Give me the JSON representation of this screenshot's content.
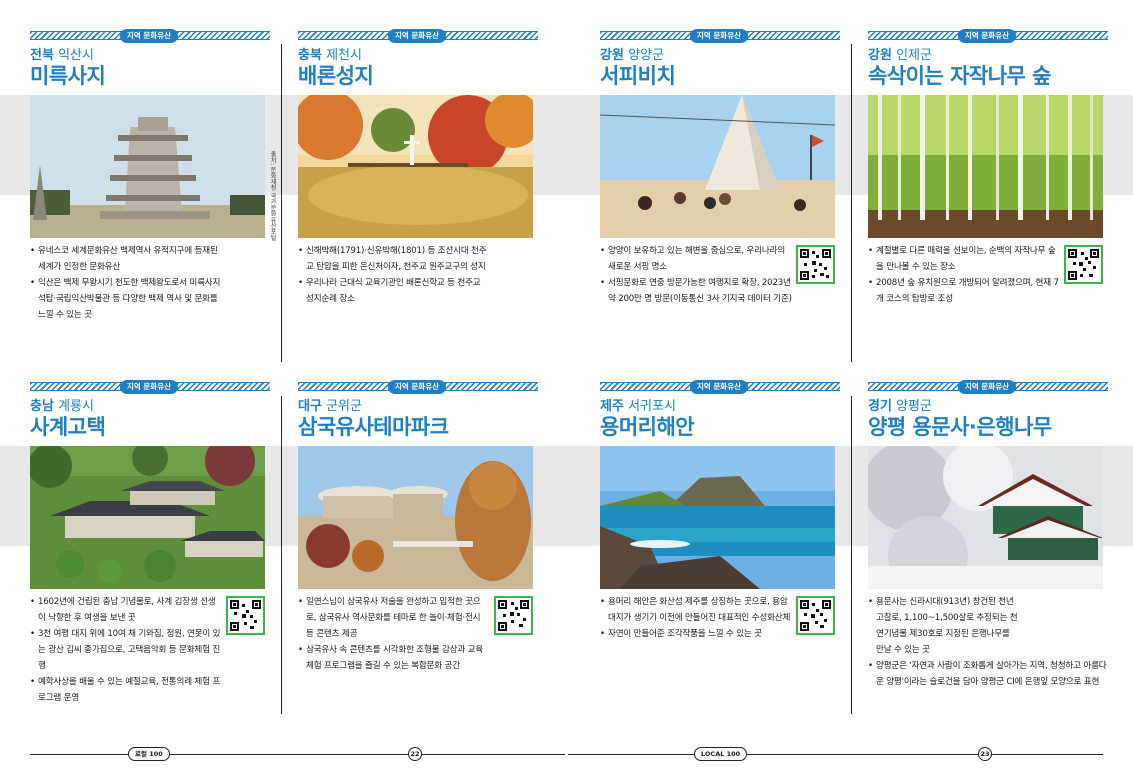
{
  "badge_label": "지역 문화유산",
  "cards": [
    {
      "province": "전북",
      "city": "익산시",
      "title": "미륵사지",
      "bullets": [
        "유네스코 세계문화유산 백제역사 유적지구에 등재된 세계가 인정한 문화유산",
        "익산은 백제 무왕시기 천도한 백제왕도로서 미륵사지석탑·국립익산박물관 등 다양한 백제 역사 및 문화를 느낄 수 있는 곳"
      ],
      "credit": "출처: 문화재청 국가문화유산포털",
      "has_qr": false,
      "photo": "stone-pagoda"
    },
    {
      "province": "충북",
      "city": "제천시",
      "title": "배론성지",
      "bullets": [
        "신해박해(1791)·신유박해(1801) 등 조선시대 천주교 탄압을 피한 은신처이자, 천주교 원주교구의 성지",
        "우리나라 근대식 교육기관인 배론신학교 등 천주교 성지순례 장소"
      ],
      "has_qr": false,
      "photo": "autumn-pond"
    },
    {
      "province": "강원",
      "city": "양양군",
      "title": "서피비치",
      "bullets": [
        "양양이 보유하고 있는 해변을 중심으로, 우리나라의 새로운 서핑 명소",
        "서핑문화로 연중 방문가능한 여행지로 확장, 2023년 약 200만 명 방문(이동통신 3사 기지국 데이터 기준)"
      ],
      "has_qr": true,
      "photo": "beach-tent"
    },
    {
      "province": "강원",
      "city": "인제군",
      "title": "속삭이는 자작나무 숲",
      "bullets": [
        "계절별로 다른 매력을 선보이는, 순백의 자작나무 숲을 만나볼 수 있는 장소",
        "2008년 숲 유치원으로 개방되어 알려졌으며, 현재 7개 코스의 탐방로 조성"
      ],
      "has_qr": true,
      "photo": "birch-forest"
    },
    {
      "province": "충남",
      "city": "계룡시",
      "title": "사계고택",
      "bullets": [
        "1602년에 건립된 충남 기념물로, 사계 김장생 선생이 낙향한 후 여생을 보낸 곳",
        "3천 여평 대지 위에 10여 채 기와집, 정원, 연못이 있는 광산 김씨 종가집으로, 고택음악회 등 문화체험 진행",
        "예학사상을 배울 수 있는 예절교육, 전통의례 체험 프로그램 운영"
      ],
      "has_qr": true,
      "photo": "hanok"
    },
    {
      "province": "대구",
      "city": "군위군",
      "title": "삼국유사테마파크",
      "bullets": [
        "일연스님이 삼국유사 저술을 완성하고 입적한 곳으로, 삼국유사 역사문화를 테마로 한 놀이·체험·전시 등 콘텐츠 제공",
        "삼국유사 속 콘텐츠를 시각화한 조형물 감상과 교육체험 프로그램을 즐길 수 있는 복합문화 공간"
      ],
      "has_qr": true,
      "photo": "theme-park"
    },
    {
      "province": "제주",
      "city": "서귀포시",
      "title": "용머리해안",
      "bullets": [
        "용머리 해안은 화산섬 제주를 상징하는 곳으로, 용암대지가 생기기 이전에 만들어진 대표적인 수성화산체",
        "자연이 만들어준 조각작품을 느낄 수 있는 곳"
      ],
      "has_qr": true,
      "photo": "coast"
    },
    {
      "province": "경기",
      "city": "양평군",
      "title": "양평 용문사·은행나무",
      "bullets": [
        "용문사는 신라시대(913년) 창건된 천년 고찰로, 1,100~1,500살로 추정되는 천연기념물 제30호로 지정된 은행나무를 만날 수 있는 곳",
        "양평군은 '자연과 사람이 조화롭게 살아가는 지역, 청청하고 아름다운 양평'이라는 슬로건을 담아 양평군 CI에 은행잎 모양으로 표현"
      ],
      "has_qr": false,
      "photo": "snow-temple"
    }
  ],
  "footer": {
    "left_label": "로컬 100",
    "left_page": "22",
    "right_label": "LOCAL 100",
    "right_page": "23"
  },
  "colors": {
    "accent": "#1f7fc4",
    "qr_border": "#39b54a"
  }
}
